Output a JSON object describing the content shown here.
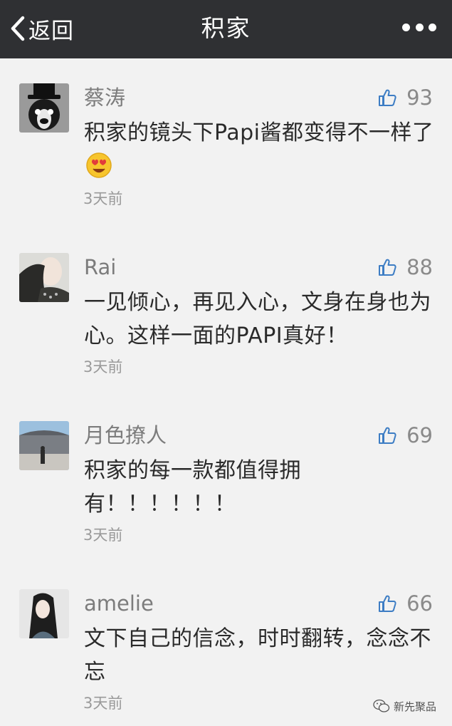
{
  "navbar": {
    "back_label": "返回",
    "title": "积家",
    "back_icon": "chevron-left-icon",
    "more_icon": "more-dots-icon"
  },
  "comments": [
    {
      "author": "蔡涛",
      "likes": "93",
      "text": "积家的镜头下Papi酱都变得不一样了",
      "emoji": "heart-eyes-emoji",
      "time": "3天前"
    },
    {
      "author": "Rai",
      "likes": "88",
      "text": "一见倾心，再见入心，文身在身也为心。这样一面的PAPI真好！",
      "time": "3天前"
    },
    {
      "author": "月色撩人",
      "likes": "69",
      "text": "积家的每一款都值得拥有！！！！！！",
      "time": "3天前"
    },
    {
      "author": "amelie",
      "likes": "66",
      "text": "文下自己的信念，时时翻转，念念不忘",
      "time": "3天前"
    }
  ],
  "watermark": {
    "label": "新先聚品",
    "icon": "wechat-icon"
  },
  "colors": {
    "navbar": "#2f3033",
    "background": "#f2f2f2",
    "like_icon": "#3d7dc4"
  }
}
